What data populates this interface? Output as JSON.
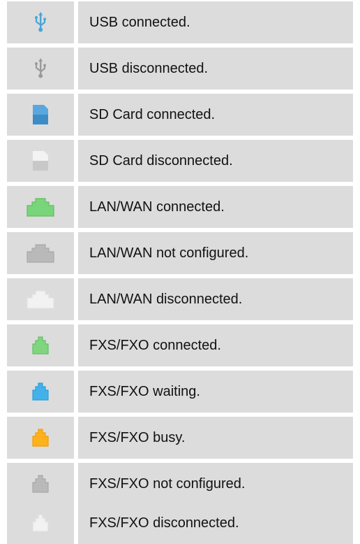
{
  "status_legend": {
    "rows": [
      {
        "icon": "usb-icon",
        "state": "connected",
        "color": "#4aa3d8",
        "label": "USB connected."
      },
      {
        "icon": "usb-icon",
        "state": "disconnected",
        "color": "#9a9a9a",
        "label": "USB disconnected."
      },
      {
        "icon": "sd-card-icon",
        "state": "connected",
        "color": "#5aa7e0",
        "label": "SD Card connected."
      },
      {
        "icon": "sd-card-icon",
        "state": "disconnected",
        "color": "#f3f3f3",
        "label": "SD Card disconnected."
      },
      {
        "icon": "lan-port-icon",
        "state": "connected",
        "color": "#79d579",
        "label": "LAN/WAN connected."
      },
      {
        "icon": "lan-port-icon",
        "state": "not-configured",
        "color": "#b9b9b9",
        "label": "LAN/WAN not configured."
      },
      {
        "icon": "lan-port-icon",
        "state": "disconnected",
        "color": "#f2f2f2",
        "label": "LAN/WAN disconnected."
      },
      {
        "icon": "phone-port-icon",
        "state": "connected",
        "color": "#7fd67f",
        "label": "FXS/FXO connected."
      },
      {
        "icon": "phone-port-icon",
        "state": "waiting",
        "color": "#43b2ea",
        "label": "FXS/FXO waiting."
      },
      {
        "icon": "phone-port-icon",
        "state": "busy",
        "color": "#ffb11c",
        "label": "FXS/FXO busy."
      },
      {
        "icon": "phone-port-icon",
        "state": "not-configured",
        "color": "#b9b9b9",
        "label": "FXS/FXO not configured."
      },
      {
        "icon": "phone-port-icon",
        "state": "disconnected",
        "color": "#f2f2f2",
        "label": "FXS/FXO disconnected."
      }
    ]
  }
}
